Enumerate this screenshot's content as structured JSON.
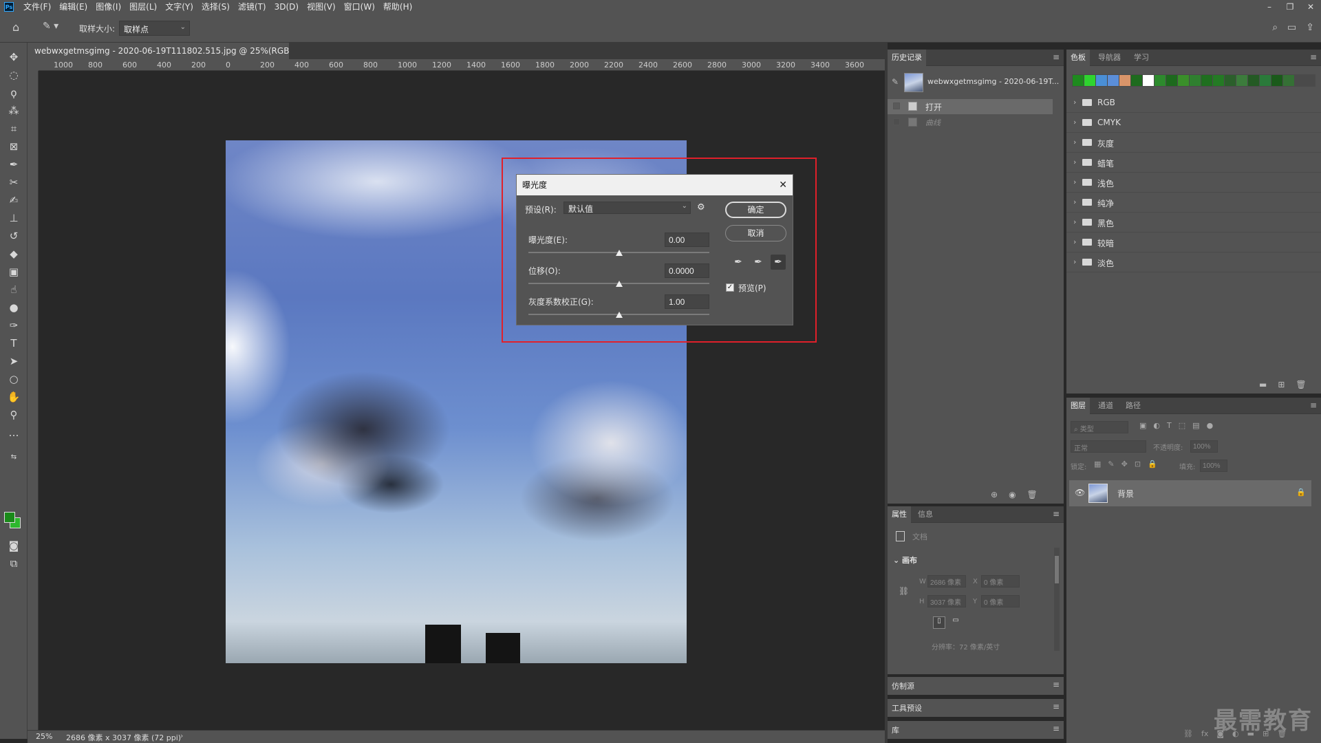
{
  "menubar": {
    "logo": "Ps",
    "items": [
      "文件(F)",
      "编辑(E)",
      "图像(I)",
      "图层(L)",
      "文字(Y)",
      "选择(S)",
      "滤镜(T)",
      "3D(D)",
      "视图(V)",
      "窗口(W)",
      "帮助(H)"
    ],
    "window_controls": [
      "–",
      "❐",
      "✕"
    ]
  },
  "options_bar": {
    "sample_size_label": "取样大小:",
    "sample_size_value": "取样点"
  },
  "document": {
    "tab_title": "webwxgetmsgimg - 2020-06-19T111802.515.jpg @ 25%(RGB/8*) *",
    "tab_close": "×"
  },
  "ruler_top": [
    "1000",
    "800",
    "600",
    "400",
    "200",
    "0",
    "200",
    "400",
    "600",
    "800",
    "1000",
    "1200",
    "1400",
    "1600",
    "1800",
    "2000",
    "2200",
    "2400",
    "2600",
    "2800",
    "3000",
    "3200",
    "3400",
    "3600"
  ],
  "dialog": {
    "title": "曝光度",
    "close": "✕",
    "preset_label": "预设(R):",
    "preset_value": "默认值",
    "exposure_label": "曝光度(E):",
    "exposure_value": "0.00",
    "offset_label": "位移(O):",
    "offset_value": "0.0000",
    "gamma_label": "灰度系数校正(G):",
    "gamma_value": "1.00",
    "ok": "确定",
    "cancel": "取消",
    "preview_label": "预览(P)",
    "preview_checked": true
  },
  "history": {
    "tab": "历史记录",
    "snapshot": "webwxgetmsgimg - 2020-06-19T...",
    "items": [
      {
        "label": "打开",
        "active": true
      },
      {
        "label": "曲线",
        "active": false
      }
    ]
  },
  "swatches_panel": {
    "tabs": [
      "色板",
      "导航器",
      "学习"
    ],
    "colors": [
      "#1e8a1e",
      "#2fd42f",
      "#4a8fd6",
      "#5b8ed8",
      "#d9956a",
      "#1e6b1e",
      "#ffffff",
      "#2d8a2d",
      "#1d6a1d",
      "#3a8f2a",
      "#2f7f2f",
      "#1f6f1f",
      "#247a24",
      "#2b5f2b",
      "#3c7c3c",
      "#245a24",
      "#2a7a3a",
      "#1a5a1a",
      "#357035"
    ],
    "groups": [
      "RGB",
      "CMYK",
      "灰度",
      "蜡笔",
      "浅色",
      "纯净",
      "黑色",
      "较暗",
      "淡色"
    ]
  },
  "properties": {
    "tabs": [
      "属性",
      "信息"
    ],
    "doc_label": "文档",
    "canvas_section": "画布",
    "w_label": "W",
    "w_value": "2686 像素",
    "h_label": "H",
    "h_value": "3037 像素",
    "x_label": "X",
    "x_value": "0 像素",
    "y_label": "Y",
    "y_value": "0 像素",
    "resolution": "分辨率：72 像素/英寸"
  },
  "collapsed_panels": [
    "仿制源",
    "工具预设",
    "库"
  ],
  "layers": {
    "tabs": [
      "图层",
      "通道",
      "路径"
    ],
    "filter_placeholder": "类型",
    "blend_mode": "正常",
    "opacity_label": "不透明度:",
    "opacity_value": "100%",
    "lock_label": "锁定:",
    "fill_label": "填充:",
    "fill_value": "100%",
    "layer_name": "背景"
  },
  "status": {
    "zoom": "25%",
    "info": "2686 像素 x 3037 像素 (72 ppi)"
  },
  "watermark": "最需教育"
}
